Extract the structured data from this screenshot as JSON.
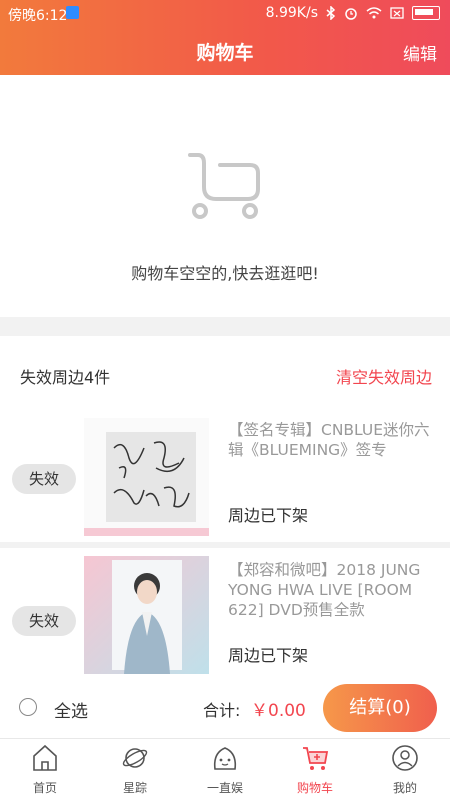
{
  "status_bar": {
    "time": "傍晚6:12",
    "speed": "8.99K/s"
  },
  "header": {
    "title": "购物车",
    "edit_label": "编辑"
  },
  "empty_state": {
    "text": "购物车空空的,快去逛逛吧!"
  },
  "invalid_section": {
    "count_label": "失效周边4件",
    "clear_label": "清空失效周边",
    "items": [
      {
        "badge": "失效",
        "title": "【签名专辑】CNBLUE迷你六辑《BLUEMING》签专",
        "status": "周边已下架"
      },
      {
        "badge": "失效",
        "title": "【郑容和微吧】2018 JUNG YONG HWA LIVE [ROOM 622] DVD预售全款",
        "status": "周边已下架"
      }
    ]
  },
  "bottom_bar": {
    "select_all": "全选",
    "total_label": "合计:",
    "total_value": "￥0.00",
    "checkout_label": "结算(0)"
  },
  "tabs": [
    {
      "label": "首页",
      "icon": "home-icon"
    },
    {
      "label": "星踪",
      "icon": "planet-icon"
    },
    {
      "label": "一直娱",
      "icon": "mascot-icon"
    },
    {
      "label": "购物车",
      "icon": "cart-icon",
      "active": true
    },
    {
      "label": "我的",
      "icon": "profile-icon"
    }
  ],
  "colors": {
    "accent": "#f2464f",
    "header_start": "#f27a3c",
    "header_end": "#ef4b5b",
    "checkout_start": "#f6984a"
  }
}
